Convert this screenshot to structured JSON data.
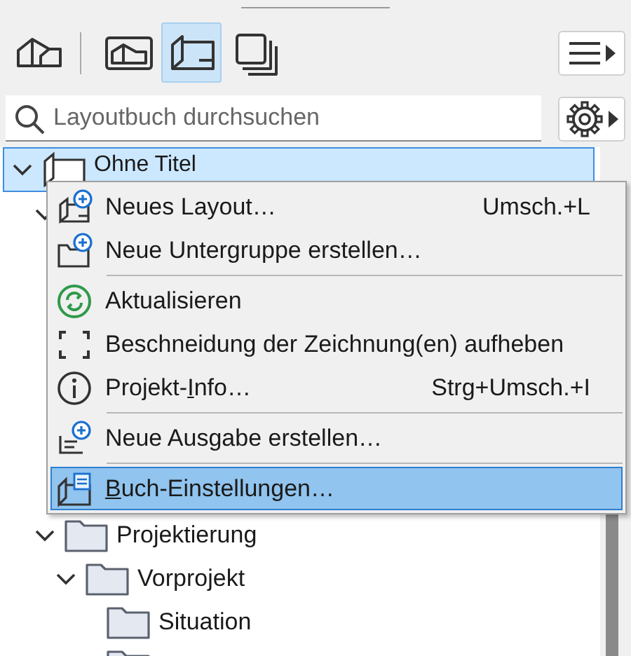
{
  "toolbar": {
    "views": [
      {
        "selected": false
      },
      {
        "selected": false
      },
      {
        "selected": true
      },
      {
        "selected": false
      }
    ]
  },
  "search": {
    "placeholder": "Layoutbuch durchsuchen"
  },
  "tree": [
    {
      "kind": "book",
      "label": "Ohne Titel",
      "selected": true,
      "expanded": true,
      "children": [
        {
          "expanded": true
        },
        {
          "kind": "folder",
          "label": "Projektierung",
          "expanded": true,
          "children": [
            {
              "kind": "folder",
              "label": "Vorprojekt",
              "expanded": true,
              "children": [
                {
                  "kind": "folder",
                  "label": "Situation"
                },
                {
                  "kind": "folder"
                }
              ]
            }
          ]
        }
      ]
    }
  ],
  "context_menu": [
    {
      "kind": "item",
      "label": "Neues Layout…",
      "shortcut": "Umsch.+L",
      "selected": false
    },
    {
      "kind": "item",
      "label": "Neue Untergruppe erstellen…",
      "selected": false
    },
    {
      "kind": "separator"
    },
    {
      "kind": "item",
      "label": "Aktualisieren",
      "selected": false
    },
    {
      "kind": "item",
      "label": "Beschneidung der Zeichnung(en) aufheben",
      "selected": false
    },
    {
      "kind": "item",
      "label": "Projekt-",
      "mnemonic": "I",
      "label_after": "nfo…",
      "shortcut": "Strg+Umsch.+I",
      "selected": false
    },
    {
      "kind": "separator"
    },
    {
      "kind": "item",
      "label": "Neue Ausgabe erstellen…",
      "selected": false
    },
    {
      "kind": "separator"
    },
    {
      "kind": "item",
      "mnemonic": "B",
      "label_after": "uch-Einstellungen…",
      "selected": true
    }
  ]
}
